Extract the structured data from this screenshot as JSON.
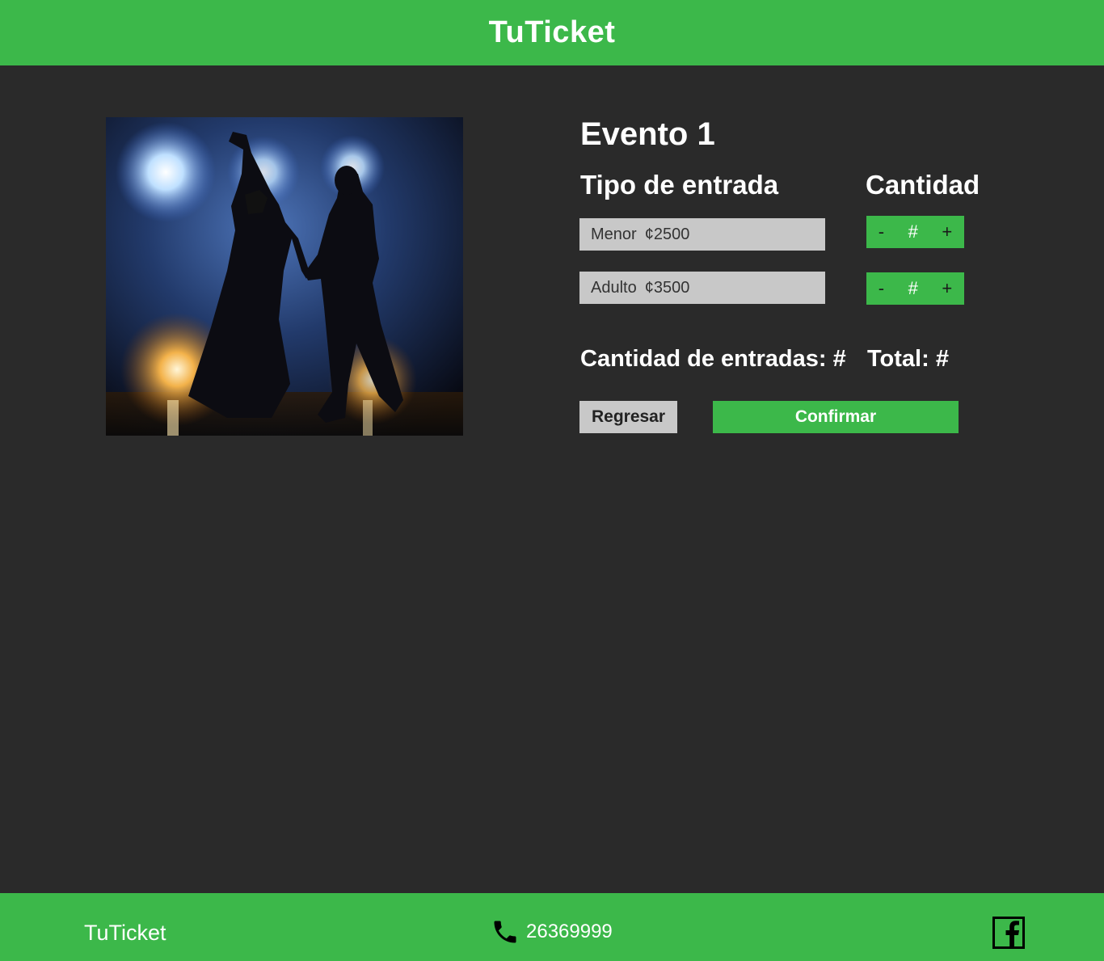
{
  "header": {
    "title": "TuTicket"
  },
  "event": {
    "title": "Evento 1",
    "image_icon": "dancers-photo"
  },
  "columns": {
    "type_label": "Tipo de entrada",
    "qty_label": "Cantidad"
  },
  "tickets": [
    {
      "name": "Menor",
      "price": "¢2500",
      "qty": "#",
      "minus": "-",
      "plus": "+"
    },
    {
      "name": "Adulto",
      "price": "¢3500",
      "qty": "#",
      "minus": "-",
      "plus": "+"
    }
  ],
  "summary": {
    "count_label": "Cantidad de entradas: #",
    "total_label": "Total: #"
  },
  "actions": {
    "back_label": "Regresar",
    "confirm_label": "Confirmar"
  },
  "footer": {
    "brand": "TuTicket",
    "phone": "26369999",
    "phone_icon": "phone-icon",
    "social_icon": "facebook-icon"
  },
  "colors": {
    "brand_green": "#3cb84a",
    "background": "#2a2a2a",
    "input_gray": "#c8c8c8"
  }
}
